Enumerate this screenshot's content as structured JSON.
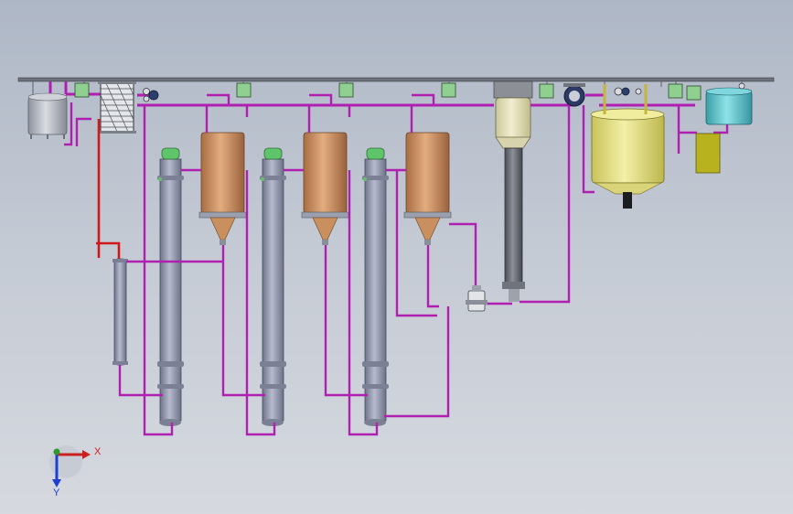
{
  "axes": {
    "x_label": "X",
    "y_label": "Y",
    "x_color": "#cc1f1f",
    "y_color": "#2a9b2a",
    "z_color": "#1f3fd0"
  },
  "colors": {
    "pipe": "#b020b0",
    "hot_pipe": "#d01818",
    "column": "#8e93aa",
    "column_cap": "#5fc56a",
    "separator": "#c98f5f",
    "yellow_tank": "#e6e28a",
    "cyan_tank": "#59c2c8",
    "olive_box": "#b9b21f",
    "controller_box": "#8fcf8f",
    "steel": "#a9adb5"
  },
  "icons": {
    "plate_heat_exchanger": "plate-heat-exchanger-icon",
    "vacuum_pump": "vacuum-pump-icon",
    "pressure_gauge": "pressure-gauge-icon",
    "valve": "valve-icon"
  }
}
